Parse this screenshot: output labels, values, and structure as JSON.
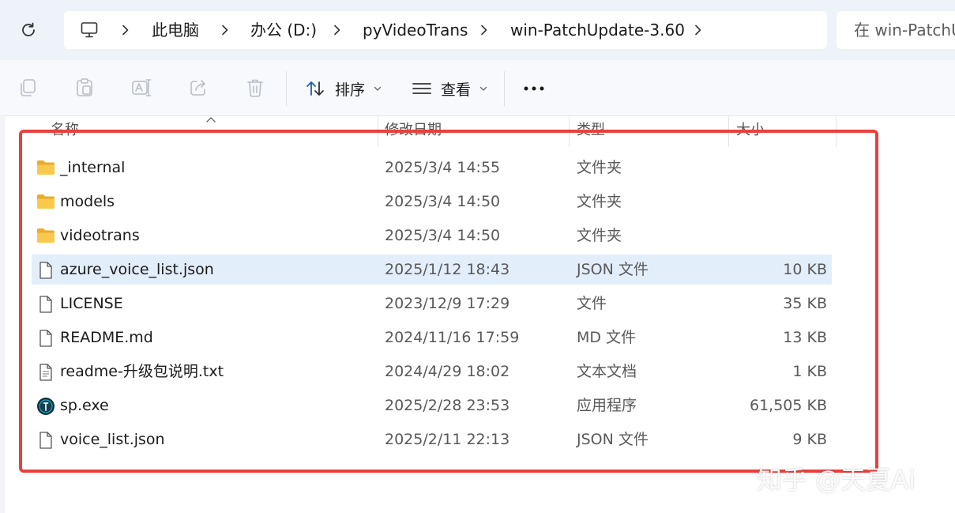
{
  "address_bar": {
    "crumbs": [
      "此电脑",
      "办公 (D:)",
      "pyVideoTrans",
      "win-PatchUpdate-3.60"
    ],
    "search_placeholder": "在 win-PatchU"
  },
  "toolbar": {
    "sort_label": "排序",
    "view_label": "查看",
    "more_label": "..."
  },
  "columns": {
    "name": "名称",
    "date": "修改日期",
    "type": "类型",
    "size": "大小"
  },
  "files": [
    {
      "name": "_internal",
      "date": "2025/3/4 14:55",
      "type": "文件夹",
      "size": "",
      "icon": "folder-icon"
    },
    {
      "name": "models",
      "date": "2025/3/4 14:50",
      "type": "文件夹",
      "size": "",
      "icon": "folder-icon"
    },
    {
      "name": "videotrans",
      "date": "2025/3/4 14:50",
      "type": "文件夹",
      "size": "",
      "icon": "folder-icon"
    },
    {
      "name": "azure_voice_list.json",
      "date": "2025/1/12 18:43",
      "type": "JSON 文件",
      "size": "10 KB",
      "icon": "file-icon",
      "selected": true
    },
    {
      "name": "LICENSE",
      "date": "2023/12/9 17:29",
      "type": "文件",
      "size": "35 KB",
      "icon": "file-icon"
    },
    {
      "name": "README.md",
      "date": "2024/11/16 17:59",
      "type": "MD 文件",
      "size": "13 KB",
      "icon": "file-icon"
    },
    {
      "name": "readme-升级包说明.txt",
      "date": "2024/4/29 18:02",
      "type": "文本文档",
      "size": "1 KB",
      "icon": "text-file-icon"
    },
    {
      "name": "sp.exe",
      "date": "2025/2/28 23:53",
      "type": "应用程序",
      "size": "61,505 KB",
      "icon": "app-icon"
    },
    {
      "name": "voice_list.json",
      "date": "2025/2/11 22:13",
      "type": "JSON 文件",
      "size": "9 KB",
      "icon": "file-icon"
    }
  ],
  "watermark": "知乎 @天夏Ai",
  "colors": {
    "highlight": "#e8413d",
    "selected_row": "#e3eefb",
    "folder": "#f6c544"
  }
}
